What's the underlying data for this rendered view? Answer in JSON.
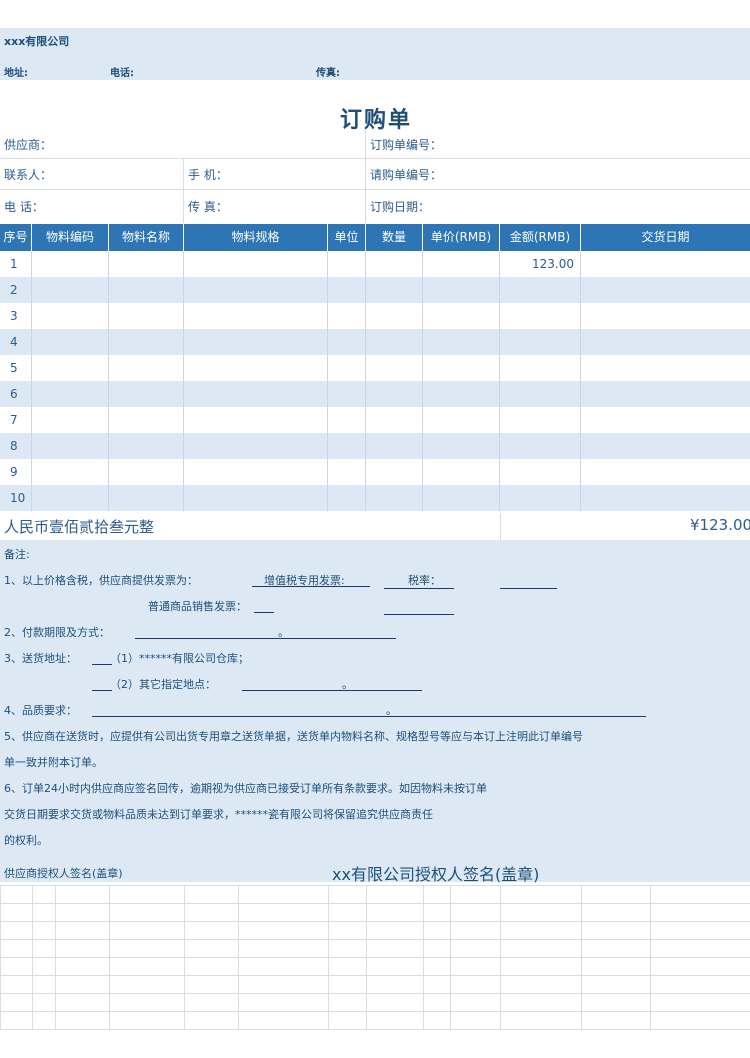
{
  "company": {
    "name": "xxx有限公司",
    "address_label": "地址:",
    "phone_label": "电话:",
    "fax_label": "传真:"
  },
  "title": "订购单",
  "info": {
    "supplier": "供应商：",
    "po_number": "订购单编号：",
    "contact": "联系人：",
    "mobile": "手 机：",
    "request_number": "请购单编号：",
    "phone": "电 话：",
    "fax": "传 真：",
    "po_date": "订购日期："
  },
  "table": {
    "headers": [
      "序号",
      "物料编码",
      "物料名称",
      "物料规格",
      "单位",
      "数量",
      "单价(RMB)",
      "金额(RMB)",
      "交货日期"
    ],
    "rows": [
      {
        "no": "1",
        "amount": "123.00"
      },
      {
        "no": "2",
        "amount": ""
      },
      {
        "no": "3",
        "amount": ""
      },
      {
        "no": "4",
        "amount": ""
      },
      {
        "no": "5",
        "amount": ""
      },
      {
        "no": "6",
        "amount": ""
      },
      {
        "no": "7",
        "amount": ""
      },
      {
        "no": "8",
        "amount": ""
      },
      {
        "no": "9",
        "amount": ""
      },
      {
        "no": "10",
        "amount": ""
      }
    ]
  },
  "total": {
    "words": "人民币壹佰贰拾叁元整",
    "amount": "¥123.00"
  },
  "notes": {
    "title": "备注:",
    "n1": "1、以上价格含税，供应商提供发票为：",
    "n1_vat": "增值税专用发票:",
    "n1_rate": "税率：",
    "n1_normal": "普通商品销售发票：",
    "n2": "2、付款期限及方式：",
    "n3": "3、送货地址：",
    "n3_opt1": "（1）******有限公司仓库；",
    "n3_opt2": "（2）其它指定地点：",
    "n4": "4、品质要求：",
    "n5a": "5、供应商在送货时，应提供有公司出货专用章之送货单据，送货单内物料名称、规格型号等应与本订上注明此订单编号",
    "n5b": "单一致并附本订单。",
    "n6a": "6、订单24小时内供应商应签名回传，逾期视为供应商已接受订单所有条款要求。如因物料未按订单",
    "n6b": "交货日期要求交货或物料品质未达到订单要求，******瓷有限公司将保留追究供应商责任",
    "n6c": "的权利。",
    "dot": "。"
  },
  "signature": {
    "supplier": "供应商授权人签名(盖章)",
    "company": "xx有限公司授权人签名(盖章)"
  }
}
